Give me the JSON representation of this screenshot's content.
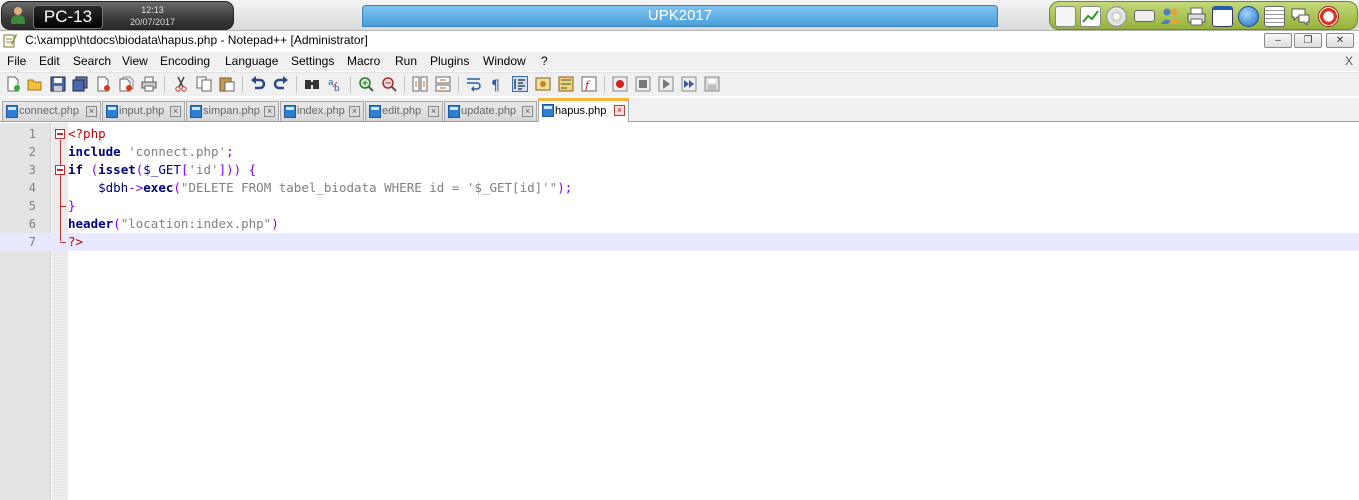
{
  "kiosk": {
    "pc_name": "PC-13",
    "time": "12:13",
    "date": "20/07/2017",
    "banner": "UPK2017",
    "tray_icons": [
      "monitor-icon",
      "chart-icon",
      "cd-icon",
      "keyboard-icon",
      "users-icon",
      "printer-icon",
      "window-icon",
      "globe-icon",
      "notes-icon",
      "chat-icon",
      "help-icon"
    ]
  },
  "window": {
    "title": "C:\\xampp\\htdocs\\biodata\\hapus.php - Notepad++ [Administrator]",
    "minimize": "‒",
    "restore": "❐",
    "close": "✕"
  },
  "menu": {
    "items": [
      "File",
      "Edit",
      "Search",
      "View",
      "Encoding",
      "Language",
      "Settings",
      "Macro",
      "Run",
      "Plugins",
      "Window",
      "?"
    ],
    "close": "X"
  },
  "tabs": [
    {
      "label": "connect.php",
      "active": false
    },
    {
      "label": "input.php",
      "active": false
    },
    {
      "label": "simpan.php",
      "active": false
    },
    {
      "label": "index.php",
      "active": false
    },
    {
      "label": "edit.php",
      "active": false
    },
    {
      "label": "update.php",
      "active": false
    },
    {
      "label": "hapus.php",
      "active": true
    }
  ],
  "editor": {
    "line_numbers": [
      "1",
      "2",
      "3",
      "4",
      "5",
      "6",
      "7"
    ],
    "current_line": 7,
    "lines": {
      "l1": {
        "tag": "<?php"
      },
      "l2": {
        "kw": "include",
        "str": "'connect.php'",
        "end": ";"
      },
      "l3": {
        "kw": "if",
        "p1": "(",
        "fn": "isset",
        "p2": "(",
        "var": "$_GET",
        "b1": "[",
        "str": "'id'",
        "b2": "])) {"
      },
      "l4": {
        "var": "$dbh",
        "arrow": "->",
        "fn": "exec",
        "p1": "(",
        "str": "\"DELETE FROM tabel_biodata WHERE id = '$_GET[id]'\"",
        "end": ");"
      },
      "l5": {
        "brace": "}"
      },
      "l6": {
        "kw": "header",
        "p1": "(",
        "str": "\"location:index.php\"",
        "p2": ")"
      },
      "l7": {
        "tag": "?>"
      }
    }
  }
}
